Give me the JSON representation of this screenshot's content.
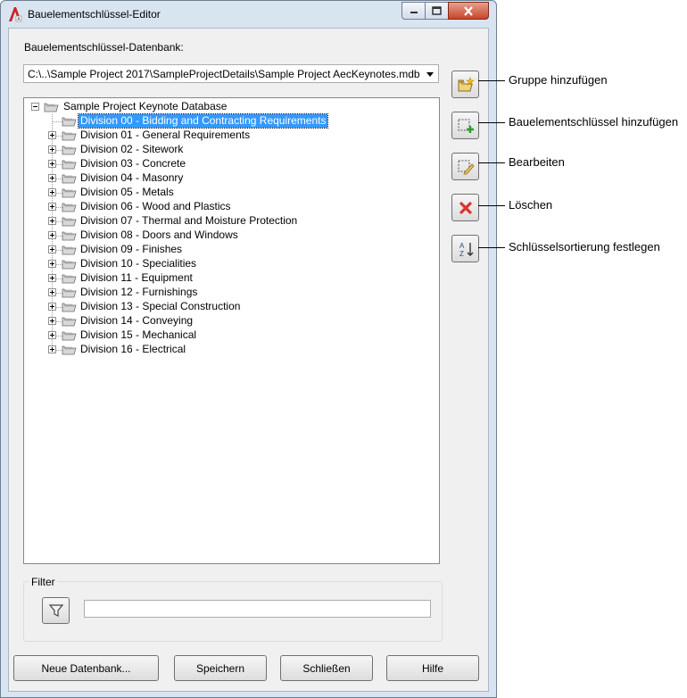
{
  "window": {
    "title": "Bauelementschlüssel-Editor"
  },
  "database": {
    "label": "Bauelementschlüssel-Datenbank:",
    "path": "C:\\..\\Sample Project 2017\\SampleProjectDetails\\Sample Project AecKeynotes.mdb"
  },
  "tree": {
    "root": "Sample Project Keynote Database",
    "items": [
      {
        "label": "Division 00 - Bidding and Contracting Requirements",
        "selected": true,
        "expandable": false
      },
      {
        "label": "Division 01 - General Requirements",
        "expandable": true
      },
      {
        "label": "Division 02 - Sitework",
        "expandable": true
      },
      {
        "label": "Division 03 - Concrete",
        "expandable": true
      },
      {
        "label": "Division 04 - Masonry",
        "expandable": true
      },
      {
        "label": "Division 05 - Metals",
        "expandable": true
      },
      {
        "label": "Division 06 - Wood and Plastics",
        "expandable": true
      },
      {
        "label": "Division 07 - Thermal and Moisture Protection",
        "expandable": true
      },
      {
        "label": "Division 08 - Doors and Windows",
        "expandable": true
      },
      {
        "label": "Division 09 - Finishes",
        "expandable": true
      },
      {
        "label": "Division 10 - Specialities",
        "expandable": true
      },
      {
        "label": "Division 11 - Equipment",
        "expandable": true
      },
      {
        "label": "Division 12 - Furnishings",
        "expandable": true
      },
      {
        "label": "Division 13 - Special Construction",
        "expandable": true
      },
      {
        "label": "Division 14 - Conveying",
        "expandable": true
      },
      {
        "label": "Division 15 - Mechanical",
        "expandable": true
      },
      {
        "label": "Division 16 - Electrical",
        "expandable": true
      }
    ]
  },
  "side_buttons": [
    {
      "name": "add-group-button",
      "icon": "folder-star-icon",
      "callout": "Gruppe hinzufügen"
    },
    {
      "name": "add-keynote-button",
      "icon": "add-keynote-icon",
      "callout": "Bauelementschlüssel hinzufügen"
    },
    {
      "name": "edit-button",
      "icon": "edit-pencil-icon",
      "callout": "Bearbeiten"
    },
    {
      "name": "delete-button",
      "icon": "delete-x-icon",
      "callout": "Löschen"
    },
    {
      "name": "sort-button",
      "icon": "sort-az-icon",
      "callout": "Schlüsselsortierung festlegen"
    }
  ],
  "filter": {
    "label": "Filter",
    "value": ""
  },
  "buttons": {
    "new_db": "Neue Datenbank...",
    "save": "Speichern",
    "close": "Schließen",
    "help": "Hilfe"
  },
  "colors": {
    "selection": "#3399ff",
    "delete_red": "#d9342b"
  }
}
